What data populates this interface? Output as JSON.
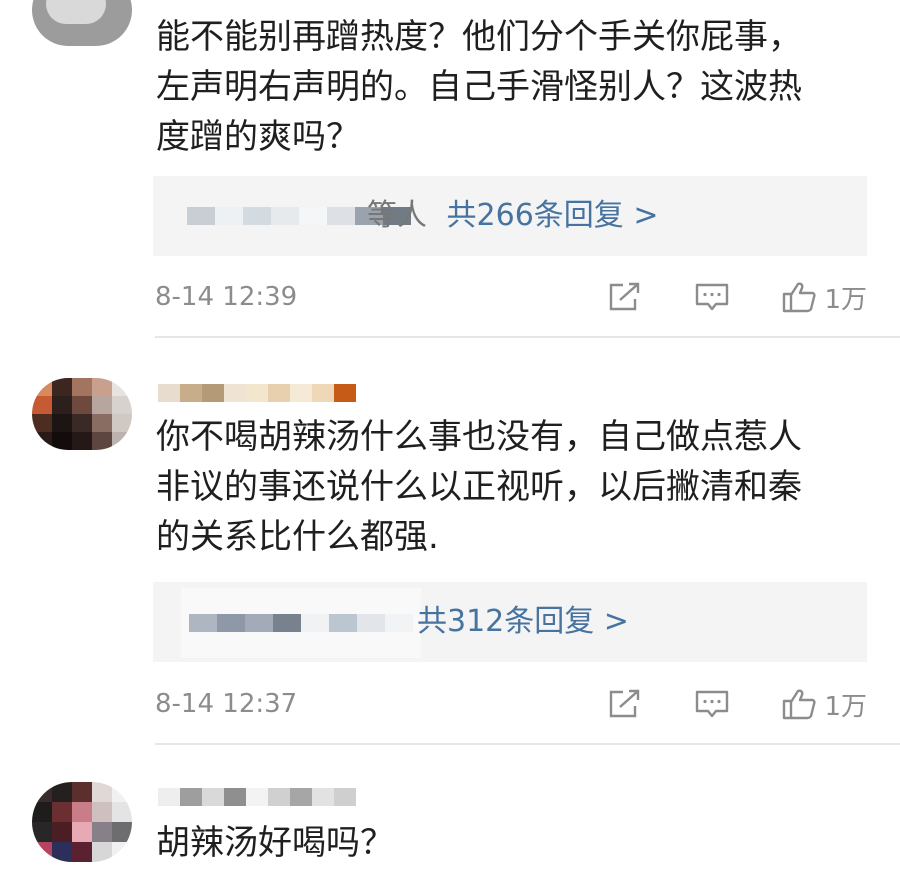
{
  "comments": [
    {
      "body": "能不能别再蹭热度？他们分个手关你屁事，\n左声明右声明的。自己手滑怪别人？这波热\n度蹭的爽吗？",
      "reply_partial": "等人",
      "reply_link": "共266条回复 >",
      "timestamp": "8-14 12:39",
      "like_count": "1万"
    },
    {
      "body": "你不喝胡辣汤什么事也没有，自己做点惹人\n非议的事还说什么以正视听，以后撇清和秦\n的关系比什么都强.",
      "reply_link": "共312条回复 >",
      "timestamp": "8-14 12:37",
      "like_count": "1万"
    },
    {
      "body": "胡辣汤好喝吗？"
    }
  ],
  "icons": {
    "share": "share-icon",
    "comment": "comment-icon",
    "like": "thumbs-up-icon"
  },
  "colors": {
    "link": "#46739f",
    "meta": "#8c8c8c",
    "reply_bg": "#f4f4f4"
  }
}
